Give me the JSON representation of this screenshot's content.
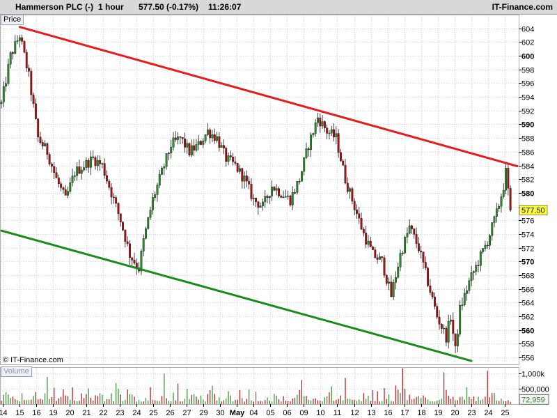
{
  "header": {
    "instrument": "Hammerson PLC (-)",
    "interval": "1 hour",
    "last": "577.50 (-0.17%)",
    "time": "11:26:07",
    "brand": "IT-Finance.com"
  },
  "price_tag": "Price",
  "volume_tag": "Volume",
  "copyright": "© IT-Finance.com",
  "colors": {
    "up": "#2e8b2e",
    "down": "#aa1111",
    "resistance": "#e61c1c",
    "support": "#1a8a1a",
    "grid": "#d4d4d4",
    "current_price_bg": "#ffff33"
  },
  "chart_data": [
    {
      "type": "candlestick",
      "ylim": [
        555,
        606
      ],
      "y_ticks": [
        {
          "v": 604,
          "bold": false
        },
        {
          "v": 602,
          "bold": false
        },
        {
          "v": 600,
          "bold": true
        },
        {
          "v": 598,
          "bold": false
        },
        {
          "v": 596,
          "bold": false
        },
        {
          "v": 594,
          "bold": false
        },
        {
          "v": 592,
          "bold": false
        },
        {
          "v": 590,
          "bold": true
        },
        {
          "v": 588,
          "bold": false
        },
        {
          "v": 586,
          "bold": false
        },
        {
          "v": 584,
          "bold": false
        },
        {
          "v": 582,
          "bold": false
        },
        {
          "v": 580,
          "bold": true
        },
        {
          "v": 578,
          "bold": false
        },
        {
          "v": 576,
          "bold": false
        },
        {
          "v": 574,
          "bold": false
        },
        {
          "v": 572,
          "bold": false
        },
        {
          "v": 570,
          "bold": true
        },
        {
          "v": 568,
          "bold": false
        },
        {
          "v": 566,
          "bold": false
        },
        {
          "v": 564,
          "bold": false
        },
        {
          "v": 562,
          "bold": false
        },
        {
          "v": 560,
          "bold": true
        },
        {
          "v": 558,
          "bold": false
        },
        {
          "v": 556,
          "bold": false
        }
      ],
      "current_price": "577.50",
      "current_value": 577.5,
      "x_labels": [
        {
          "label": "14",
          "pos": 0.5
        },
        {
          "label": "15",
          "pos": 7.8
        },
        {
          "label": "16",
          "pos": 15.1
        },
        {
          "label": "19",
          "pos": 22.4
        },
        {
          "label": "20",
          "pos": 29.7
        },
        {
          "label": "21",
          "pos": 37.0
        },
        {
          "label": "22",
          "pos": 44.3
        },
        {
          "label": "23",
          "pos": 51.6
        },
        {
          "label": "24",
          "pos": 58.9
        },
        {
          "label": "25",
          "pos": 66.2
        },
        {
          "label": "26",
          "pos": 73.5
        },
        {
          "label": "27",
          "pos": 80.8
        },
        {
          "label": "29",
          "pos": 88.1
        },
        {
          "label": "30",
          "pos": 95.4
        },
        {
          "label": "May",
          "pos": 102.7,
          "bold": true
        },
        {
          "label": "04",
          "pos": 110.0
        },
        {
          "label": "05",
          "pos": 117.3
        },
        {
          "label": "06",
          "pos": 124.6
        },
        {
          "label": "09",
          "pos": 131.9
        },
        {
          "label": "10",
          "pos": 139.2
        },
        {
          "label": "11",
          "pos": 146.5
        },
        {
          "label": "12",
          "pos": 153.8
        },
        {
          "label": "13",
          "pos": 161.1
        },
        {
          "label": "16",
          "pos": 168.4
        },
        {
          "label": "17",
          "pos": 175.7
        },
        {
          "label": "18",
          "pos": 183.0
        },
        {
          "label": "19",
          "pos": 190.3
        },
        {
          "label": "20",
          "pos": 197.6
        },
        {
          "label": "23",
          "pos": 204.9
        },
        {
          "label": "24",
          "pos": 212.2
        },
        {
          "label": "25",
          "pos": 219.5
        }
      ],
      "x_range": [
        0,
        222
      ],
      "anchors": [
        [
          0,
          593
        ],
        [
          4,
          600
        ],
        [
          8,
          603
        ],
        [
          12,
          597
        ],
        [
          16,
          588
        ],
        [
          20,
          586
        ],
        [
          24,
          582
        ],
        [
          28,
          579
        ],
        [
          32,
          583
        ],
        [
          36,
          584
        ],
        [
          40,
          585
        ],
        [
          44,
          584
        ],
        [
          48,
          580
        ],
        [
          52,
          576
        ],
        [
          56,
          571
        ],
        [
          60,
          569
        ],
        [
          62,
          573
        ],
        [
          66,
          579
        ],
        [
          70,
          583
        ],
        [
          74,
          587
        ],
        [
          78,
          588
        ],
        [
          82,
          586
        ],
        [
          86,
          587
        ],
        [
          90,
          589
        ],
        [
          94,
          588
        ],
        [
          98,
          585
        ],
        [
          102,
          584
        ],
        [
          106,
          582
        ],
        [
          110,
          579
        ],
        [
          114,
          578
        ],
        [
          118,
          581
        ],
        [
          122,
          580
        ],
        [
          126,
          579
        ],
        [
          130,
          582
        ],
        [
          134,
          587
        ],
        [
          138,
          591
        ],
        [
          142,
          589
        ],
        [
          146,
          588
        ],
        [
          150,
          582
        ],
        [
          154,
          578
        ],
        [
          158,
          574
        ],
        [
          162,
          571
        ],
        [
          166,
          570
        ],
        [
          170,
          565
        ],
        [
          174,
          571
        ],
        [
          178,
          575
        ],
        [
          182,
          572
        ],
        [
          186,
          567
        ],
        [
          190,
          562
        ],
        [
          194,
          559
        ],
        [
          196,
          562
        ],
        [
          198,
          557
        ],
        [
          200,
          563
        ],
        [
          204,
          567
        ],
        [
          208,
          570
        ],
        [
          212,
          573
        ],
        [
          216,
          577
        ],
        [
          219,
          581
        ],
        [
          220,
          583
        ],
        [
          222,
          577.5
        ]
      ],
      "trendlines": [
        {
          "name": "resistance",
          "x1": 8,
          "y1": 604.2,
          "x2": 225,
          "y2": 583.9
        },
        {
          "name": "support",
          "x1": 0,
          "y1": 574.5,
          "x2": 205,
          "y2": 555.5
        }
      ]
    },
    {
      "type": "bar",
      "title": "Volume",
      "ylim": [
        0,
        1200000
      ],
      "y_ticks": [
        {
          "label": "1,000k",
          "v": 1000000
        },
        {
          "label": "500,000",
          "v": 500000
        }
      ],
      "last_value": "72,959",
      "spikes": [
        {
          "x": 175,
          "v": 1160000
        },
        {
          "x": 193,
          "v": 1030000
        },
        {
          "x": 212,
          "v": 1080000
        },
        {
          "x": 20,
          "v": 880000
        },
        {
          "x": 71,
          "v": 1000000
        },
        {
          "x": 131,
          "v": 780000
        },
        {
          "x": 150,
          "v": 850000
        }
      ]
    }
  ]
}
